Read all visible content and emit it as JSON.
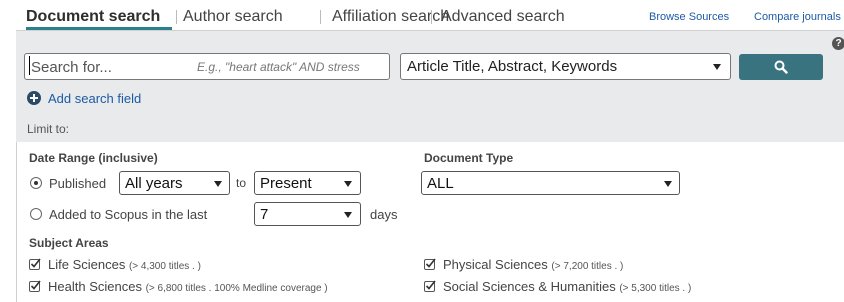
{
  "tabs": [
    {
      "label": "Document search",
      "active": true
    },
    {
      "label": "Author search",
      "active": false
    },
    {
      "label": "Affiliation search",
      "active": false
    },
    {
      "label": "Advanced search",
      "active": false
    }
  ],
  "toplinks": {
    "browse_sources": "Browse Sources",
    "compare_journals": "Compare journals"
  },
  "help_icon": "?",
  "search": {
    "placeholder": "Search for...",
    "hint": "E.g., \"heart attack\" AND stress",
    "field_selected": "Article Title, Abstract, Keywords",
    "button_icon": "search-icon"
  },
  "add_field_label": "Add search field",
  "limit_label": "Limit to:",
  "date_range": {
    "title": "Date Range (inclusive)",
    "published_label": "Published",
    "from_value": "All years",
    "to_label": "to",
    "to_value": "Present",
    "added_label": "Added to Scopus in the last",
    "days_value": "7",
    "days_label": "days"
  },
  "document_type": {
    "title": "Document Type",
    "value": "ALL"
  },
  "subject_areas": {
    "title": "Subject Areas",
    "items": [
      {
        "label": "Life Sciences",
        "note": "(> 4,300 titles . )",
        "checked": true
      },
      {
        "label": "Health Sciences",
        "note": "(> 6,800 titles . 100% Medline coverage )",
        "checked": true
      },
      {
        "label": "Physical Sciences",
        "note": "(> 7,200 titles . )",
        "checked": true
      },
      {
        "label": "Social Sciences & Humanities",
        "note": "(> 5,300 titles . )",
        "checked": true
      }
    ]
  },
  "colors": {
    "accent": "#2c7f8c",
    "search_button": "#3a7380",
    "link": "#1d5aa6",
    "panel_bg": "#e9eaeb"
  }
}
